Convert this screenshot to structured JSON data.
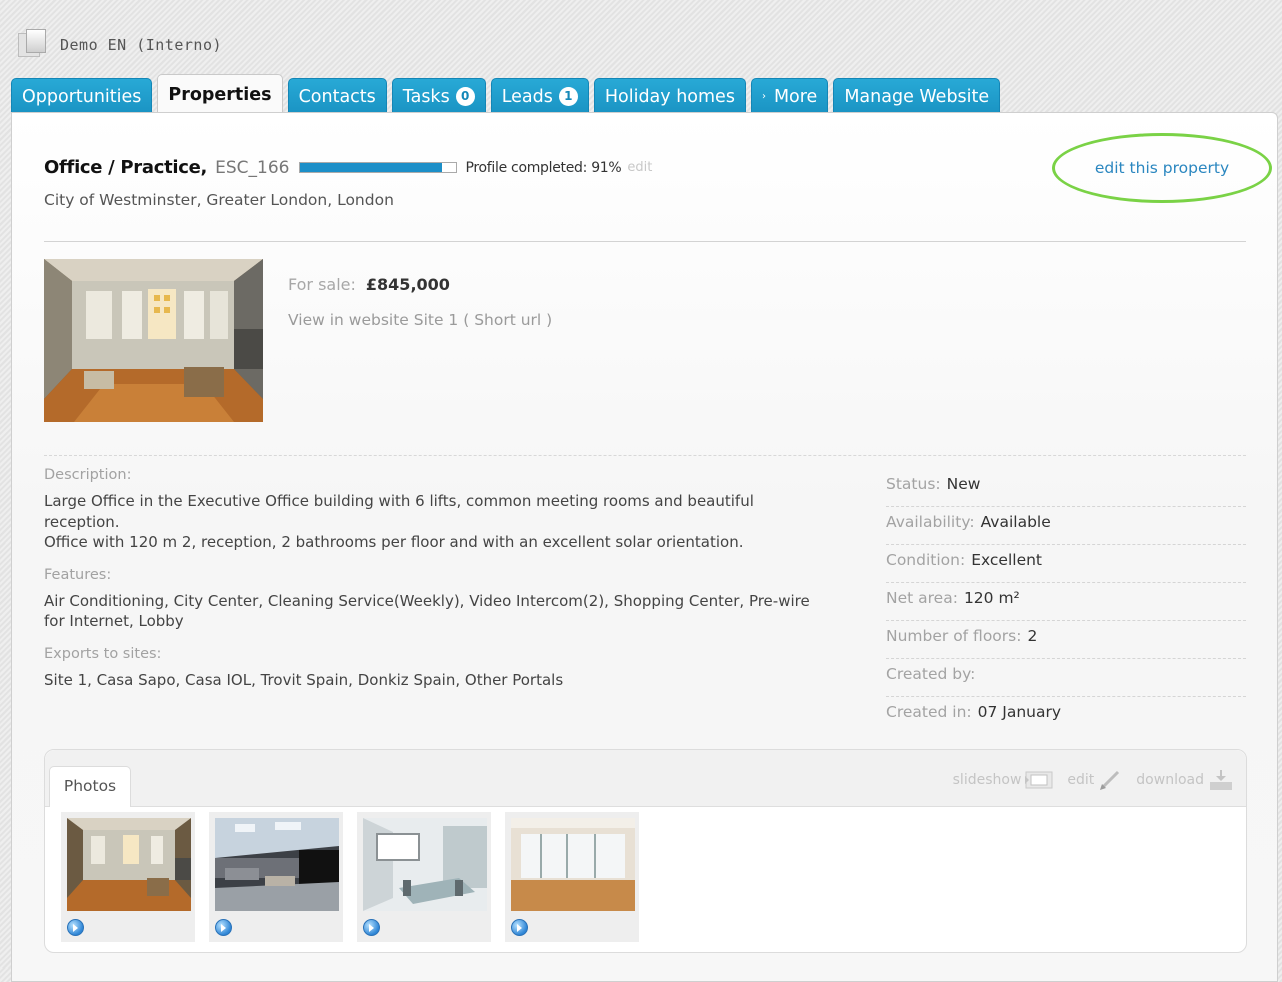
{
  "app": {
    "title": "Demo EN (Interno)",
    "icon": "app-logo-icon"
  },
  "tabs": [
    {
      "label": "Opportunities"
    },
    {
      "label": "Properties",
      "active": true
    },
    {
      "label": "Contacts"
    },
    {
      "label": "Tasks",
      "badge": "0"
    },
    {
      "label": "Leads",
      "badge": "1"
    },
    {
      "label": "Holiday homes"
    },
    {
      "label": "More",
      "icon": "arrow-right-icon",
      "arrow": "›"
    },
    {
      "label": "Manage Website"
    }
  ],
  "property": {
    "type": "Office / Practice,",
    "ref": "ESC_166",
    "profile_label": "Profile completed: 91%",
    "profile_percent": 91,
    "profile_edit": "edit",
    "location": "City of Westminster, Greater London, London",
    "edit_link": "edit this property",
    "price_label": "For sale:",
    "price": "£845,000",
    "site_line": "View in website Site 1 ( Short url )"
  },
  "description": {
    "label": "Description:",
    "line1": "Large Office in the Executive Office building with 6 lifts, common meeting rooms and beautiful reception.",
    "line2": "Office with 120 m 2, reception, 2 bathrooms per floor and with an excellent solar orientation."
  },
  "features": {
    "label": "Features:",
    "text": "Air Conditioning, City Center, Cleaning Service(Weekly), Video Intercom(2), Shopping Center, Pre-wire for Internet, Lobby"
  },
  "exports": {
    "label": "Exports to sites:",
    "text": "Site 1, Casa Sapo, Casa IOL, Trovit Spain, Donkiz Spain, Other Portals"
  },
  "details": [
    {
      "key": "Status:",
      "value": "New"
    },
    {
      "key": "Availability:",
      "value": "Available"
    },
    {
      "key": "Condition:",
      "value": "Excellent"
    },
    {
      "key": "Net area:",
      "value": "120 m²"
    },
    {
      "key": "Number of floors:",
      "value": "2"
    },
    {
      "key": "Created by:",
      "value": ""
    },
    {
      "key": "Created in:",
      "value": "07 January"
    }
  ],
  "photos": {
    "tab_label": "Photos",
    "slideshow": "slideshow",
    "edit": "edit",
    "download": "download",
    "slideshow_icon": "slideshow-icon",
    "edit_icon": "pencil-icon",
    "download_icon": "download-icon",
    "play_icon": "play-icon"
  },
  "colors": {
    "tab_blue": "#1a9ccb",
    "highlight": "#7ad246",
    "link": "#2b87c0",
    "progress": "#1c8fc8"
  }
}
